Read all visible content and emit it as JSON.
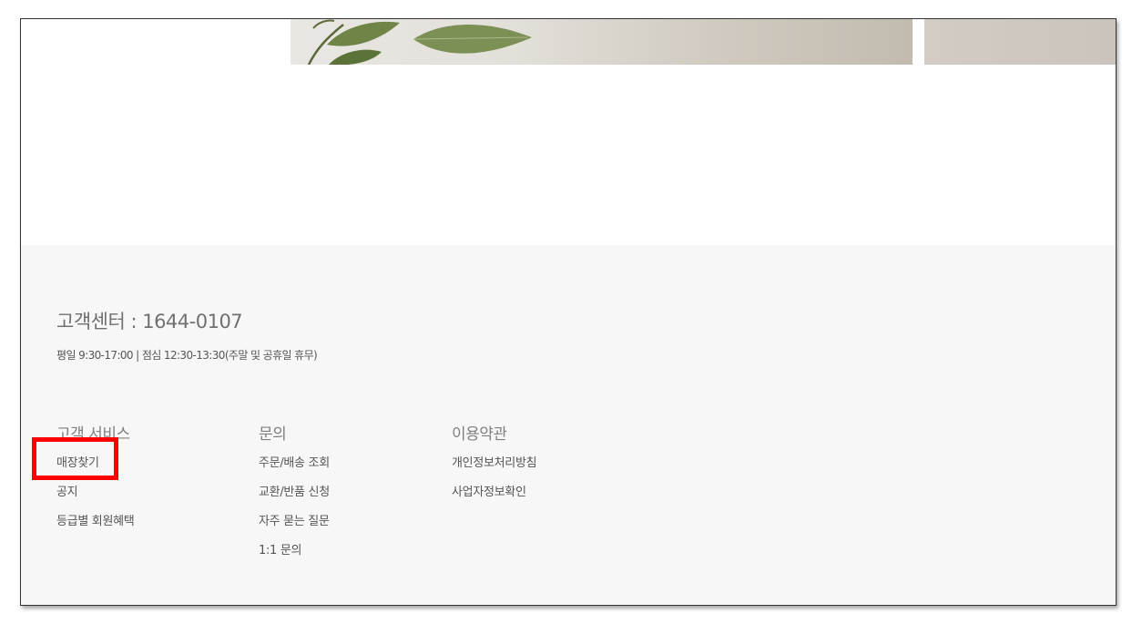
{
  "footer": {
    "customer_center": "고객센터 : 1644-0107",
    "hours": "평일 9:30-17:00  |  점심 12:30-13:30(주말 및 공휴일 휴무)",
    "columns": [
      {
        "heading": "고객 서비스",
        "links": [
          "매장찾기",
          "공지",
          "등급별 회원혜택"
        ]
      },
      {
        "heading": "문의",
        "links": [
          "주문/배송 조회",
          "교환/반품 신청",
          "자주 묻는 질문",
          "1:1 문의"
        ]
      },
      {
        "heading": "이용약관",
        "links": [
          "개인정보처리방침",
          "사업자정보확인"
        ]
      }
    ]
  },
  "highlight": {
    "color": "#ff0000",
    "target": "매장찾기"
  },
  "colors": {
    "footer_bg": "#f7f7f7",
    "text_gray": "#555555",
    "heading_gray": "#808080"
  }
}
